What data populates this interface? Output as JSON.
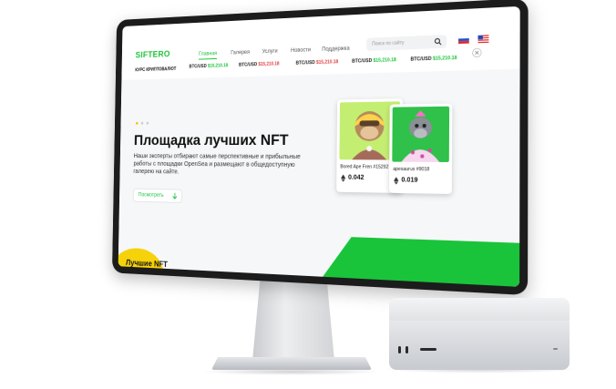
{
  "site": {
    "logo": "SIFTERO",
    "nav": [
      "Главная",
      "Галерея",
      "Услуги",
      "Новости",
      "Поддержка"
    ],
    "search_placeholder": "Поиск по сайту",
    "rates_label": "КУРС КРИПТОВАЛЮТ",
    "ticker": [
      {
        "pair": "BTC/USD",
        "price": "$15,210.18",
        "trend": "up"
      },
      {
        "pair": "BTC/USD",
        "price": "$15,210.18",
        "trend": "down"
      },
      {
        "pair": "BTC/USD",
        "price": "$15,210.18",
        "trend": "down"
      },
      {
        "pair": "BTC/USD",
        "price": "$15,210.18",
        "trend": "up"
      },
      {
        "pair": "BTC/USD",
        "price": "$15,210.18",
        "trend": "up"
      }
    ],
    "hero": {
      "title": "Площадка лучших NFT",
      "description": "Наши эксперты отбирают самые перспективные и прибыльные работы с площадки OpenSea и размещают в общедоступную галерею на сайте.",
      "button": "Посмотреть"
    },
    "cards": [
      {
        "name": "Bored Ape Fren #15292",
        "price": "0.042"
      },
      {
        "name": "apesaurus #9018",
        "price": "0.019"
      }
    ],
    "next_section_title": "Лучшие NFT"
  },
  "colors": {
    "brand": "#19c43a",
    "price_up": "#19c43a",
    "price_down": "#e23b3b",
    "card1_bg": "#c4ee72",
    "card2_bg": "#2fc14a"
  },
  "icons": [
    "search-icon",
    "flag-ru-icon",
    "flag-us-icon",
    "arrow-down-icon",
    "ethereum-icon",
    "close-icon"
  ]
}
